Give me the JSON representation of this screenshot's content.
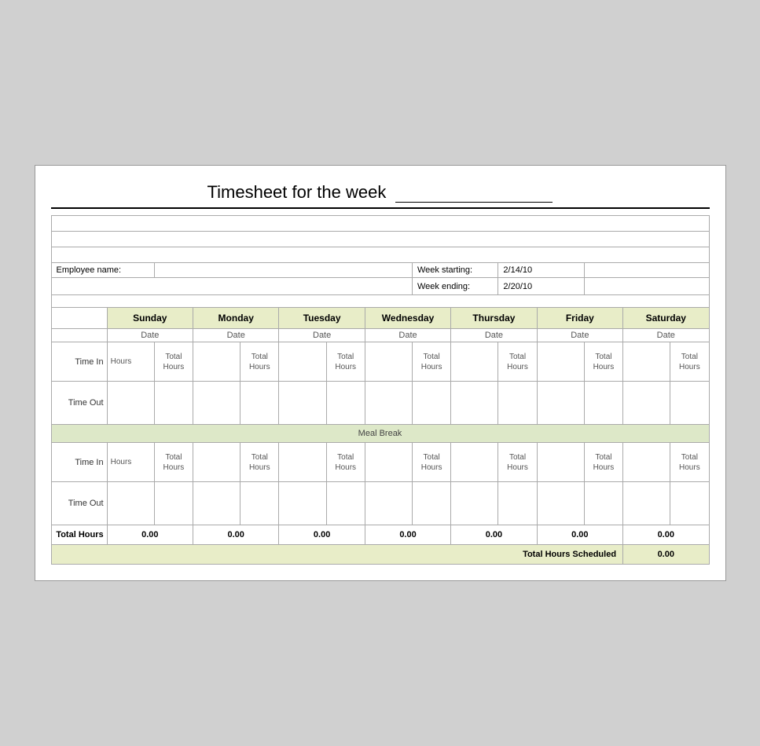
{
  "title": "Timesheet for the week",
  "week_starting": "2/14/10",
  "week_ending": "2/20/10",
  "employee_label": "Employee name:",
  "week_starting_label": "Week starting:",
  "week_ending_label": "Week ending:",
  "days": [
    "Sunday",
    "Monday",
    "Tuesday",
    "Wednesday",
    "Thursday",
    "Friday",
    "Saturday"
  ],
  "date_label": "Date",
  "time_in_label": "Time In",
  "time_out_label": "Time Out",
  "total_hours_label": "Total Hours",
  "hours_label": "Hours",
  "meal_break_label": "Meal Break",
  "totals": [
    "0.00",
    "0.00",
    "0.00",
    "0.00",
    "0.00",
    "0.00",
    "0.00"
  ],
  "total_hours_scheduled_label": "Total Hours Scheduled",
  "total_hours_scheduled_value": "0.00",
  "colors": {
    "header_green": "#e8edc8",
    "meal_break_green": "#dde8c8",
    "scheduled_green": "#e8edc8"
  }
}
